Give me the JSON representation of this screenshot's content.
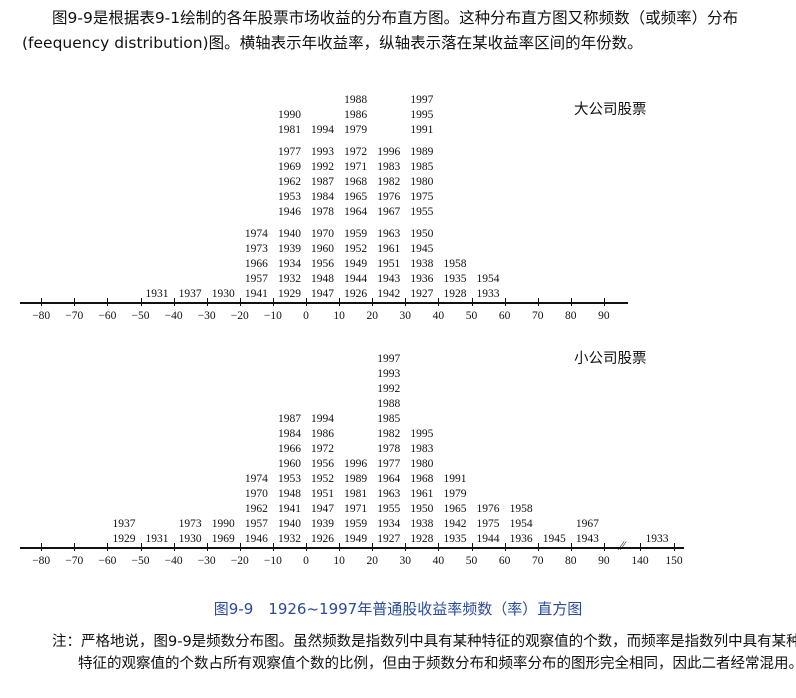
{
  "intro": "图9-9是根据表9-1绘制的各年股票市场收益的分布直方图。这种分布直方图又称频数（或频率）分布(feequency distribution)图。横轴表示年收益率，纵轴表示落在某收益率区间的年份数。",
  "chart_data": [
    {
      "type": "table",
      "title": "大公司股票",
      "axis_ticks": [
        "−80",
        "−70",
        "−60",
        "−50",
        "−40",
        "−30",
        "−20",
        "−10",
        "0",
        "10",
        "20",
        "30",
        "40",
        "50",
        "60",
        "70",
        "80",
        "90"
      ],
      "bins": [
        {
          "range": "-50~-40",
          "years": [
            "1931"
          ]
        },
        {
          "range": "-40~-30",
          "years": [
            "1937"
          ]
        },
        {
          "range": "-30~-20",
          "years": [
            "1930"
          ]
        },
        {
          "range": "-20~-10",
          "years": [
            "1941",
            "1957",
            "1966",
            "1973",
            "1974"
          ]
        },
        {
          "range": "-10~0",
          "years": [
            "1929",
            "1932",
            "1934",
            "1939",
            "1940",
            "1946",
            "1953",
            "1962",
            "1969",
            "1977",
            "1981",
            "1990"
          ]
        },
        {
          "range": "0~10",
          "years": [
            "1947",
            "1948",
            "1956",
            "1960",
            "1970",
            "1978",
            "1984",
            "1987",
            "1992",
            "1993",
            "1994"
          ]
        },
        {
          "range": "10~20",
          "years": [
            "1926",
            "1944",
            "1949",
            "1952",
            "1959",
            "1964",
            "1965",
            "1968",
            "1971",
            "1972",
            "1979",
            "1986",
            "1988"
          ]
        },
        {
          "range": "20~30",
          "years": [
            "1942",
            "1943",
            "1951",
            "1961",
            "1963",
            "1967",
            "1976",
            "1982",
            "1983",
            "1996"
          ]
        },
        {
          "range": "30~40",
          "years": [
            "1927",
            "1936",
            "1938",
            "1945",
            "1950",
            "1955",
            "1975",
            "1980",
            "1985",
            "1989",
            "1991",
            "1995",
            "1997"
          ]
        },
        {
          "range": "40~50",
          "years": [
            "1928",
            "1935",
            "1958"
          ]
        },
        {
          "range": "50~60",
          "years": [
            "1933",
            "1954"
          ]
        }
      ]
    },
    {
      "type": "table",
      "title": "小公司股票",
      "axis_ticks": [
        "−80",
        "−70",
        "−60",
        "−50",
        "−40",
        "−30",
        "−20",
        "−10",
        "0",
        "10",
        "20",
        "30",
        "40",
        "50",
        "60",
        "70",
        "80",
        "90",
        "140",
        "150"
      ],
      "bins": [
        {
          "range": "-60~-50",
          "years": [
            "1929",
            "1937"
          ]
        },
        {
          "range": "-50~-40",
          "years": [
            "1931"
          ]
        },
        {
          "range": "-40~-30",
          "years": [
            "1930",
            "1973"
          ]
        },
        {
          "range": "-30~-20",
          "years": [
            "1969",
            "1990"
          ]
        },
        {
          "range": "-20~-10",
          "years": [
            "1946",
            "1957",
            "1962",
            "1970",
            "1974"
          ]
        },
        {
          "range": "-10~0",
          "years": [
            "1932",
            "1940",
            "1941",
            "1948",
            "1953",
            "1960",
            "1966",
            "1984",
            "1987"
          ]
        },
        {
          "range": "0~10",
          "years": [
            "1926",
            "1939",
            "1947",
            "1951",
            "1952",
            "1956",
            "1972",
            "1986",
            "1994"
          ]
        },
        {
          "range": "10~20",
          "years": [
            "1949",
            "1959",
            "1971",
            "1981",
            "1989",
            "1996"
          ]
        },
        {
          "range": "20~30",
          "years": [
            "1927",
            "1934",
            "1955",
            "1963",
            "1964",
            "1977",
            "1978",
            "1982",
            "1985",
            "1988",
            "1992",
            "1993",
            "1997"
          ]
        },
        {
          "range": "30~40",
          "years": [
            "1928",
            "1938",
            "1950",
            "1961",
            "1968",
            "1980",
            "1983",
            "1995"
          ]
        },
        {
          "range": "40~50",
          "years": [
            "1935",
            "1942",
            "1965",
            "1979",
            "1991"
          ]
        },
        {
          "range": "50~60",
          "years": [
            "1944",
            "1975",
            "1976"
          ]
        },
        {
          "range": "60~70",
          "years": [
            "1936",
            "1954",
            "1958"
          ]
        },
        {
          "range": "70~80",
          "years": [
            "1945"
          ]
        },
        {
          "range": "80~90",
          "years": [
            "1943",
            "1967"
          ]
        },
        {
          "range": "140~150",
          "years": [
            "1933"
          ]
        }
      ]
    }
  ],
  "caption": "图9-9　1926~1997年普通股收益率频数（率）直方图",
  "note": "注：严格地说，图9-9是频数分布图。虽然频数是指数列中具有某种特征的观察值的个数，而频率是指数列中具有某种特征的观察值的个数占所有观察值个数的比例，但由于频数分布和频率分布的图形完全相同，因此二者经常混用。",
  "colors": {
    "caption": "#2a4a9a",
    "text": "#111111"
  }
}
